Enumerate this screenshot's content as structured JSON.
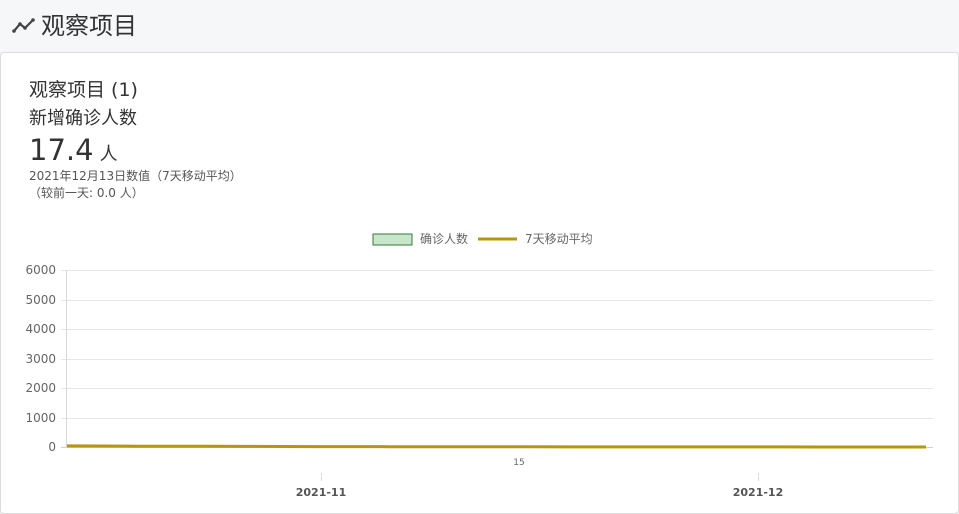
{
  "header": {
    "title": "观察项目",
    "icon": "trend-line-icon"
  },
  "card": {
    "title": "观察项目 (1)",
    "metric_name": "新增确诊人数",
    "value": "17.4",
    "unit": "人",
    "date_note": "2021年12月13日数值（7天移动平均）",
    "change_note": "（较前一天: 0.0 人）"
  },
  "chart_data": {
    "type": "bar",
    "legend": [
      {
        "name": "确诊人数",
        "kind": "bar",
        "color": "#c8e6c9",
        "border": "#2e7d32"
      },
      {
        "name": "7天移动平均",
        "kind": "line",
        "color": "#b8960b"
      }
    ],
    "legend_position": "top-center",
    "ylim": [
      0,
      6000
    ],
    "yticks": [
      "0",
      "1000",
      "2000",
      "3000",
      "4000",
      "5000",
      "6000"
    ],
    "x_minor_label": "15",
    "x_major_labels": [
      "2021-11",
      "2021-12"
    ],
    "grid": true,
    "moving_average": [
      55,
      50,
      45,
      42,
      40,
      38,
      35,
      32,
      30,
      28,
      27,
      25,
      24,
      23,
      22,
      21,
      21,
      20,
      20,
      19,
      19,
      18,
      18,
      18,
      17.4
    ]
  }
}
